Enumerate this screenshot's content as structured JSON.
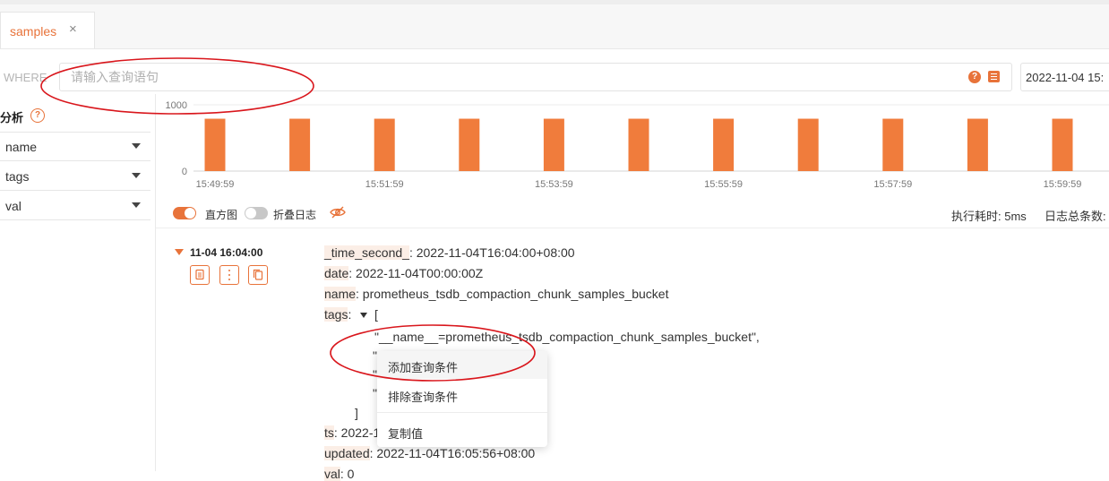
{
  "tab": {
    "label": "samples",
    "close_symbol": "×"
  },
  "query": {
    "where_label": "WHERE",
    "placeholder": "请输入查询语句",
    "help_symbol": "?",
    "time_text": "2022-11-04 15:"
  },
  "sidebar": {
    "title": "分析",
    "help_symbol": "?",
    "fields": [
      {
        "label": "name"
      },
      {
        "label": "tags"
      },
      {
        "label": "val"
      }
    ]
  },
  "chart_data": {
    "type": "bar",
    "yticks": [
      "1000",
      "0"
    ],
    "ylim": [
      0,
      1000
    ],
    "xticks": [
      "15:49:59",
      "15:51:59",
      "15:53:59",
      "15:55:59",
      "15:57:59",
      "15:59:59"
    ],
    "bars": [
      {
        "x": "15:49:59",
        "value": 790
      },
      {
        "x": "15:50:59",
        "value": 790
      },
      {
        "x": "15:51:59",
        "value": 790
      },
      {
        "x": "15:52:59",
        "value": 790
      },
      {
        "x": "15:53:59",
        "value": 790
      },
      {
        "x": "15:54:59",
        "value": 790
      },
      {
        "x": "15:55:59",
        "value": 790
      },
      {
        "x": "15:56:59",
        "value": 790
      },
      {
        "x": "15:57:59",
        "value": 790
      },
      {
        "x": "15:58:59",
        "value": 790
      },
      {
        "x": "15:59:59",
        "value": 790
      }
    ],
    "bar_color": "#f07c3c",
    "grid": true
  },
  "toolbar": {
    "histogram_label": "直方图",
    "histogram_on": true,
    "fold_label": "折叠日志",
    "fold_on": false,
    "exec_time": "执行耗时: 5ms",
    "total_count": "日志总条数:"
  },
  "log": {
    "time": "11-04 16:04:00",
    "fields": {
      "time_key": "_time_second_",
      "time_val": ": 2022-11-04T16:04:00+08:00",
      "date_key": "date",
      "date_val": ": 2022-11-04T00:00:00Z",
      "name_key": "name",
      "name_val": ": prometheus_tsdb_compaction_chunk_samples_bucket",
      "tags_key": "tags",
      "tags_colon": ":",
      "tags_open": "[",
      "tag_first": "\"__name__=prometheus_tsdb_compaction_chunk_samples_bucket\",",
      "tag_quote": "\"",
      "tags_close": "]",
      "ts_key": "ts",
      "ts_val": ": 2022-1",
      "updated_key": "updated",
      "updated_val": ": 2022-11-04T16:05:56+08:00",
      "val_key": "val",
      "val_val": ": 0"
    }
  },
  "context_menu": {
    "add": "添加查询条件",
    "exclude": "排除查询条件",
    "copy": "复制值"
  },
  "colors": {
    "accent": "#e8733a",
    "annotation": "#d9161c"
  }
}
